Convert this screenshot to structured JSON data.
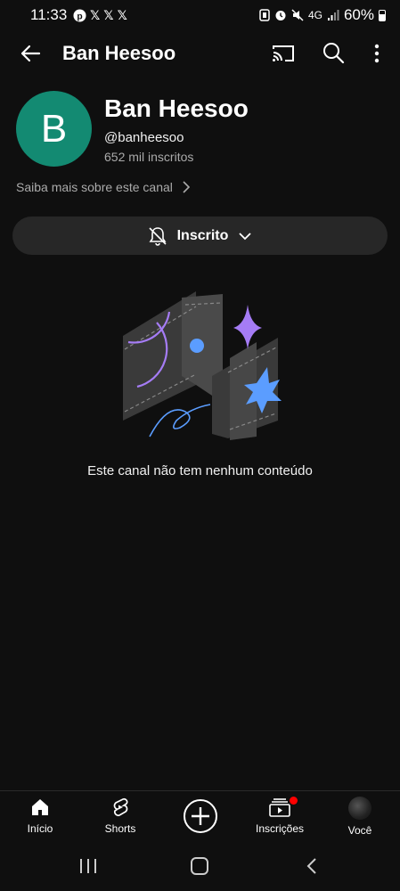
{
  "status": {
    "time": "11:33",
    "left_icons": [
      "pinterest-icon",
      "x-icon",
      "x-icon",
      "x-icon"
    ],
    "network": "4G",
    "battery": "60%"
  },
  "top_bar": {
    "title": "Ban Heesoo"
  },
  "channel": {
    "avatar_letter": "B",
    "avatar_color": "#138a72",
    "name": "Ban Heesoo",
    "handle": "@banheesoo",
    "subscribers": "652 mil inscritos",
    "more_about": "Saiba mais sobre este canal"
  },
  "subscribe_button": {
    "label": "Inscrito"
  },
  "empty_state": {
    "message": "Este canal não tem nenhum conteúdo"
  },
  "bottom_nav": {
    "items": [
      {
        "label": "Início",
        "icon": "home-icon"
      },
      {
        "label": "Shorts",
        "icon": "shorts-icon"
      },
      {
        "label": "",
        "icon": "create-icon"
      },
      {
        "label": "Inscrições",
        "icon": "subscriptions-icon"
      },
      {
        "label": "Você",
        "icon": "avatar"
      }
    ]
  },
  "colors": {
    "background": "#0f0f0f",
    "button_bg": "#272727",
    "accent_purple": "#a57cf5",
    "accent_blue": "#5b9dff",
    "notification": "#ff0000"
  }
}
